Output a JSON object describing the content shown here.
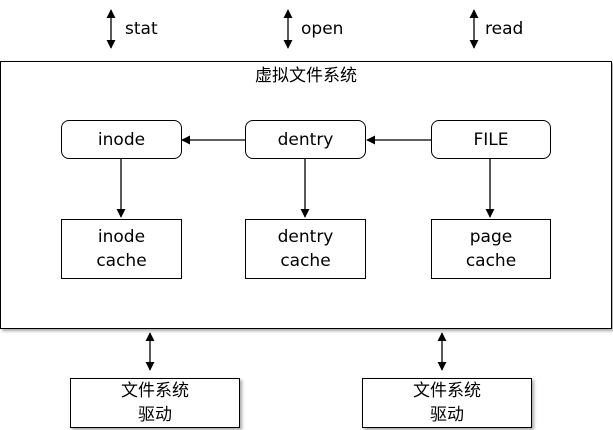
{
  "syscalls": [
    {
      "id": "stat",
      "label": "stat"
    },
    {
      "id": "open",
      "label": "open"
    },
    {
      "id": "read",
      "label": "read"
    }
  ],
  "vfs": {
    "title": "虚拟文件系统",
    "objects": [
      {
        "id": "inode",
        "label": "inode"
      },
      {
        "id": "dentry",
        "label": "dentry"
      },
      {
        "id": "file",
        "label": "FILE"
      }
    ],
    "caches": [
      {
        "id": "inode-cache",
        "label": "inode\ncache"
      },
      {
        "id": "dentry-cache",
        "label": "dentry\ncache"
      },
      {
        "id": "page-cache",
        "label": "page\ncache"
      }
    ]
  },
  "drivers": [
    {
      "id": "fs-driver-left",
      "label": "文件系统\n驱动"
    },
    {
      "id": "fs-driver-right",
      "label": "文件系统\n驱动"
    }
  ]
}
